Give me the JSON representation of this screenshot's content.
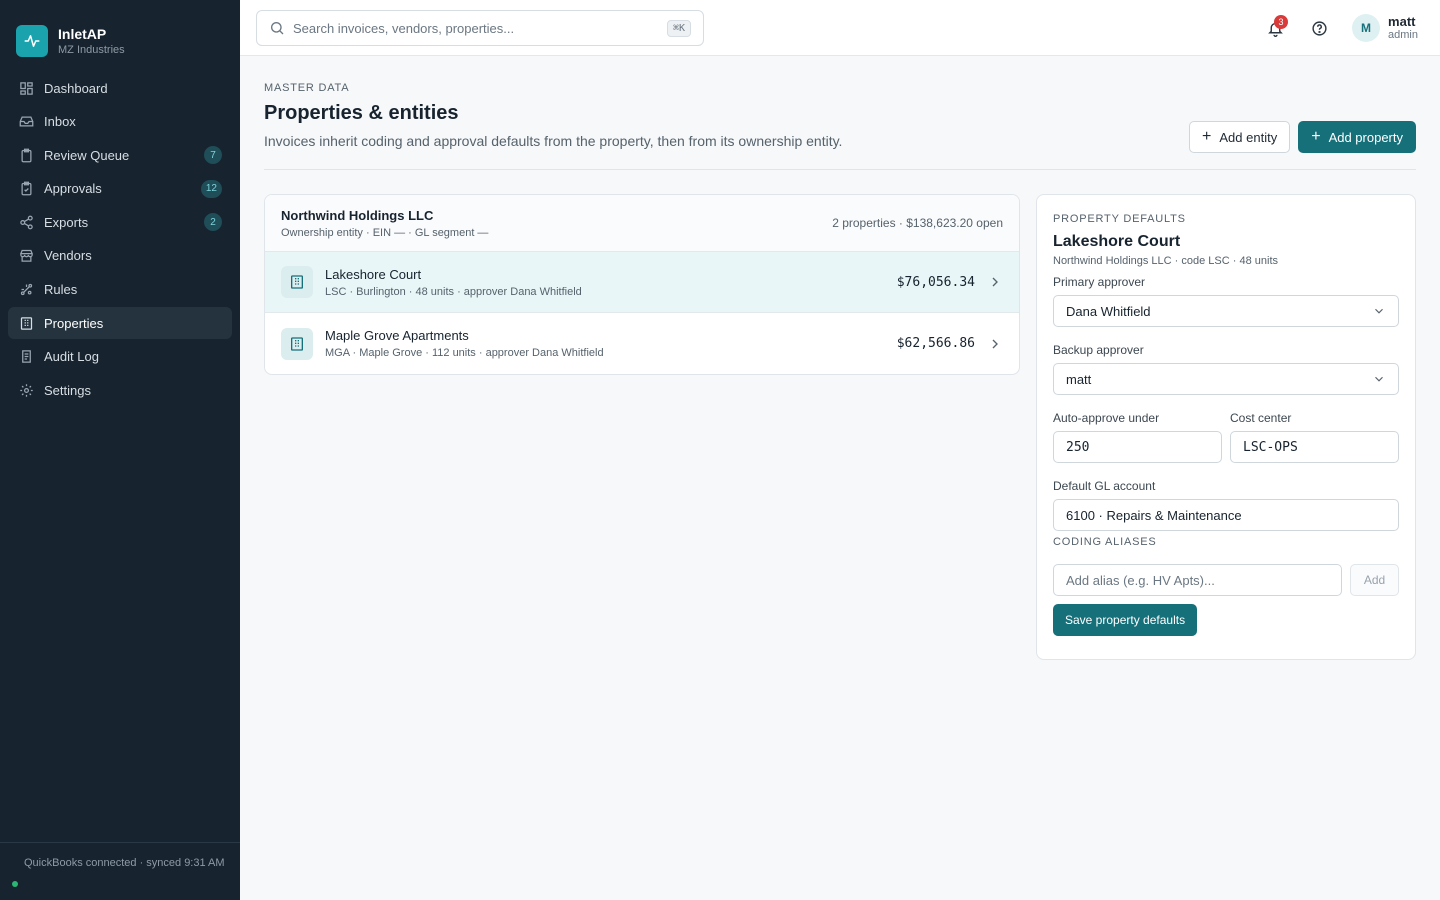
{
  "brand": {
    "name": "InletAP",
    "org": "MZ Industries"
  },
  "nav": [
    {
      "label": "Dashboard",
      "icon": "dashboard-icon",
      "badge": ""
    },
    {
      "label": "Inbox",
      "icon": "inbox-icon",
      "badge": ""
    },
    {
      "label": "Review Queue",
      "icon": "clipboard-icon",
      "badge": "7"
    },
    {
      "label": "Approvals",
      "icon": "check-clipboard-icon",
      "badge": "12"
    },
    {
      "label": "Exports",
      "icon": "share-icon",
      "badge": "2"
    },
    {
      "label": "Vendors",
      "icon": "store-icon",
      "badge": ""
    },
    {
      "label": "Rules",
      "icon": "rules-icon",
      "badge": ""
    },
    {
      "label": "Properties",
      "icon": "building-icon",
      "badge": "",
      "active": true
    },
    {
      "label": "Audit Log",
      "icon": "log-icon",
      "badge": ""
    },
    {
      "label": "Settings",
      "icon": "gear-icon",
      "badge": ""
    }
  ],
  "sync": {
    "text": "QuickBooks connected · synced 9:31 AM"
  },
  "search": {
    "placeholder": "Search invoices, vendors, properties...",
    "shortcut": "⌘K"
  },
  "notifications": {
    "count": "3"
  },
  "user": {
    "initial": "M",
    "name": "matt",
    "role": "admin"
  },
  "page": {
    "eyebrow": "MASTER DATA",
    "title": "Properties & entities",
    "description": "Invoices inherit coding and approval defaults from the property, then from its ownership entity.",
    "add_entity": "Add entity",
    "add_property": "Add property"
  },
  "entity": {
    "name": "Northwind Holdings LLC",
    "meta": "Ownership entity · EIN — · GL segment —",
    "summary": "2 properties · $138,623.20 open",
    "properties": [
      {
        "name": "Lakeshore Court",
        "meta": "LSC · Burlington · 48 units · approver Dana Whitfield",
        "amount": "$76,056.34"
      },
      {
        "name": "Maple Grove Apartments",
        "meta": "MGA · Maple Grove · 112 units · approver Dana Whitfield",
        "amount": "$62,566.86"
      }
    ]
  },
  "defaults": {
    "eyebrow": "PROPERTY DEFAULTS",
    "title": "Lakeshore Court",
    "sub": "Northwind Holdings LLC · code LSC · 48 units",
    "primary_label": "Primary approver",
    "primary_value": "Dana Whitfield",
    "backup_label": "Backup approver",
    "backup_value": "matt",
    "auto_label": "Auto-approve under",
    "auto_value": "250",
    "cost_label": "Cost center",
    "cost_value": "LSC-OPS",
    "gl_label": "Default GL account",
    "gl_value": "6100 · Repairs & Maintenance",
    "aliases_label": "CODING ALIASES",
    "alias_placeholder": "Add alias (e.g. HV Apts)...",
    "alias_add": "Add",
    "save": "Save property defaults"
  },
  "colors": {
    "sidebar": "#17232e",
    "accent": "#16707a",
    "brand": "#1aa3ad",
    "badge_red": "#d93a3a"
  }
}
